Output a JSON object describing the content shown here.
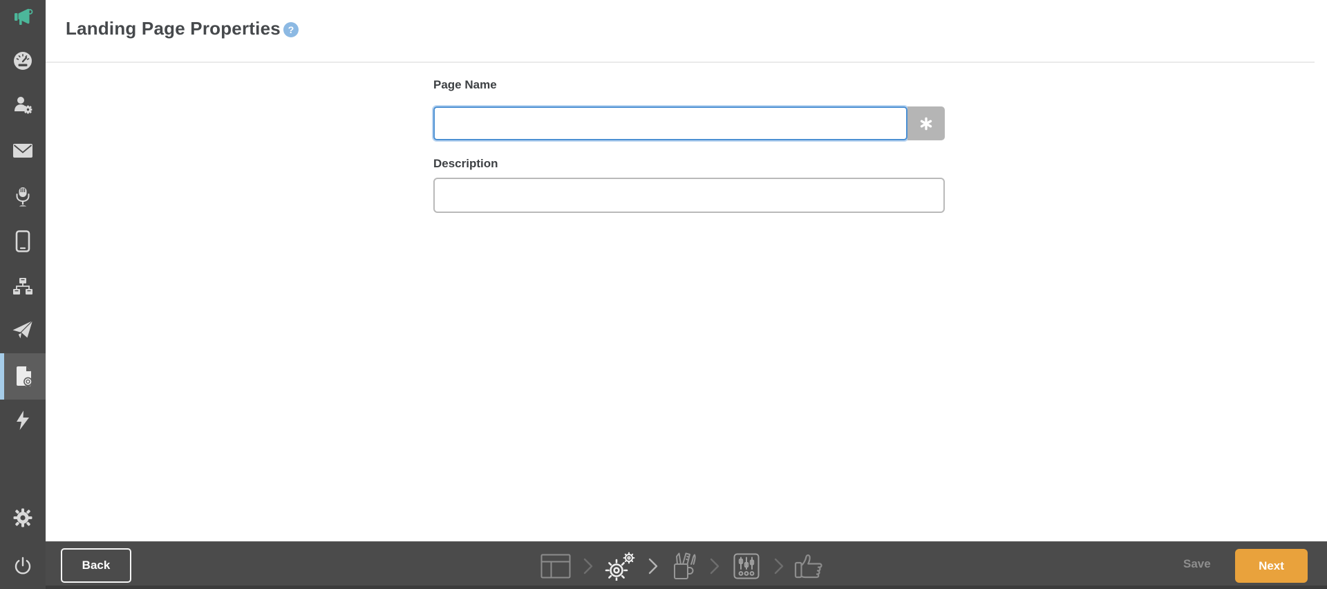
{
  "header": {
    "title": "Landing Page Properties",
    "help_label": "?"
  },
  "form": {
    "page_name": {
      "label": "Page Name",
      "value": "",
      "personalization_button_icon": "asterisk-icon"
    },
    "description": {
      "label": "Description",
      "value": ""
    }
  },
  "sidebar": {
    "items": [
      {
        "icon": "megaphone-icon",
        "active": false
      },
      {
        "icon": "dashboard-icon",
        "active": false
      },
      {
        "icon": "contacts-icon",
        "active": false
      },
      {
        "icon": "email-icon",
        "active": false
      },
      {
        "icon": "microphone-icon",
        "active": false
      },
      {
        "icon": "mobile-icon",
        "active": false
      },
      {
        "icon": "automation-sitemap-icon",
        "active": false
      },
      {
        "icon": "send-plane-icon",
        "active": false
      },
      {
        "icon": "landing-page-document-icon",
        "active": true
      },
      {
        "icon": "lightning-icon",
        "active": false
      },
      {
        "icon": "settings-gear-icon",
        "active": false
      },
      {
        "icon": "power-icon",
        "active": false
      }
    ]
  },
  "footer": {
    "back_label": "Back",
    "save_label": "Save",
    "next_label": "Next",
    "steps": [
      {
        "icon": "layout-icon",
        "state": "inactive"
      },
      {
        "icon": "gears-icon",
        "state": "active"
      },
      {
        "icon": "design-tools-icon",
        "state": "inactive"
      },
      {
        "icon": "sliders-icon",
        "state": "inactive"
      },
      {
        "icon": "thumbs-up-icon",
        "state": "inactive"
      }
    ]
  },
  "colors": {
    "sidebar_bg": "#474747",
    "sidebar_active_bg": "#5d5d5d",
    "sidebar_active_strip": "#a6cde9",
    "brand_green": "#4cb79a",
    "footer_bg": "#4b4b4b",
    "next_orange": "#e9a23c",
    "focus_blue": "#4a8fd3",
    "help_blue": "#8cb9e3",
    "divider_gray": "#eaeaea"
  }
}
